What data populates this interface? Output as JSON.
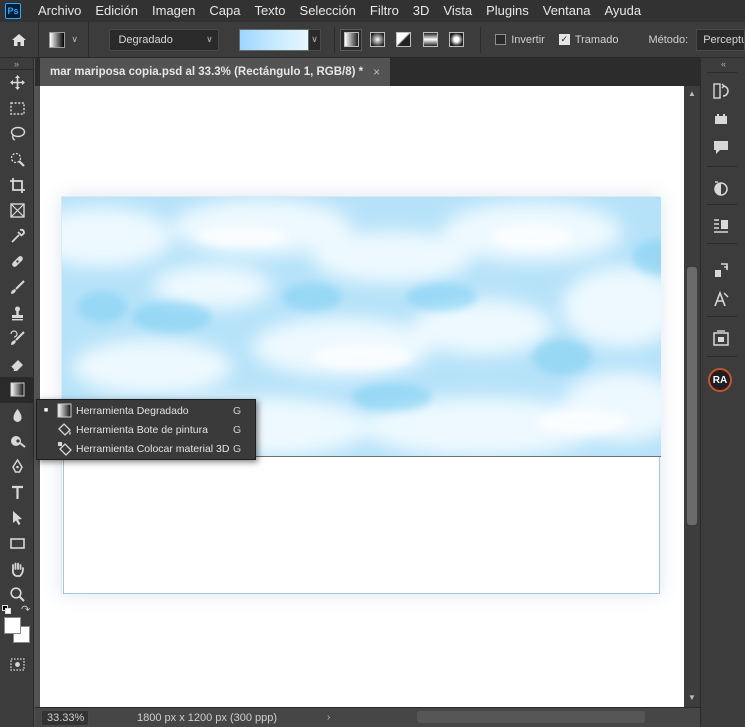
{
  "app": {
    "logo": "Ps"
  },
  "menu": [
    "Archivo",
    "Edición",
    "Imagen",
    "Capa",
    "Texto",
    "Selección",
    "Filtro",
    "3D",
    "Vista",
    "Plugins",
    "Ventana",
    "Ayuda"
  ],
  "options": {
    "preset": "Degradado",
    "invert_label": "Invertir",
    "invert_checked": false,
    "dither_label": "Tramado",
    "dither_checked": true,
    "method_label": "Método:",
    "method_value": "Perceptu",
    "gradient_colors": [
      "#9ed6ff",
      "#c6eaff",
      "#e6f6ff"
    ]
  },
  "document": {
    "tab_title": "mar mariposa copia.psd al 33.3% (Rectángulo 1, RGB/8) *",
    "close_symbol": "×"
  },
  "status": {
    "zoom": "33.33%",
    "dimensions": "1800 px x 1200 px (300 ppp)",
    "arrow": "›"
  },
  "flyout": [
    {
      "label": "Herramienta Degradado",
      "key": "G",
      "selected": true,
      "icon": "gradient-icon"
    },
    {
      "label": "Herramienta Bote de pintura",
      "key": "G",
      "selected": false,
      "icon": "paint-bucket-icon"
    },
    {
      "label": "Herramienta Colocar material 3D",
      "key": "G",
      "selected": false,
      "icon": "3d-material-drop-icon"
    }
  ],
  "tools": [
    "move-icon",
    "marquee-icon",
    "lasso-icon",
    "quick-select-icon",
    "crop-icon",
    "frame-icon",
    "eyedropper-icon",
    "healing-brush-icon",
    "brush-icon",
    "stamp-icon",
    "history-brush-icon",
    "eraser-icon",
    "gradient-icon",
    "blur-icon",
    "dodge-icon",
    "pen-icon",
    "type-icon",
    "path-select-icon",
    "rectangle-icon",
    "hand-icon",
    "zoom-icon"
  ],
  "right_panel": {
    "avatar_initials": "RA",
    "icons": [
      "history-icon",
      "actions-icon",
      "comments-icon",
      "adjustments-icon",
      "properties-icon",
      "paragraph-style-icon",
      "character-icon",
      "libraries-icon"
    ]
  },
  "colors": {
    "foreground": "#ffffff",
    "background": "#ffffff",
    "sky_base": "#b9e4fa",
    "sky_light": "#e8f7ff"
  }
}
